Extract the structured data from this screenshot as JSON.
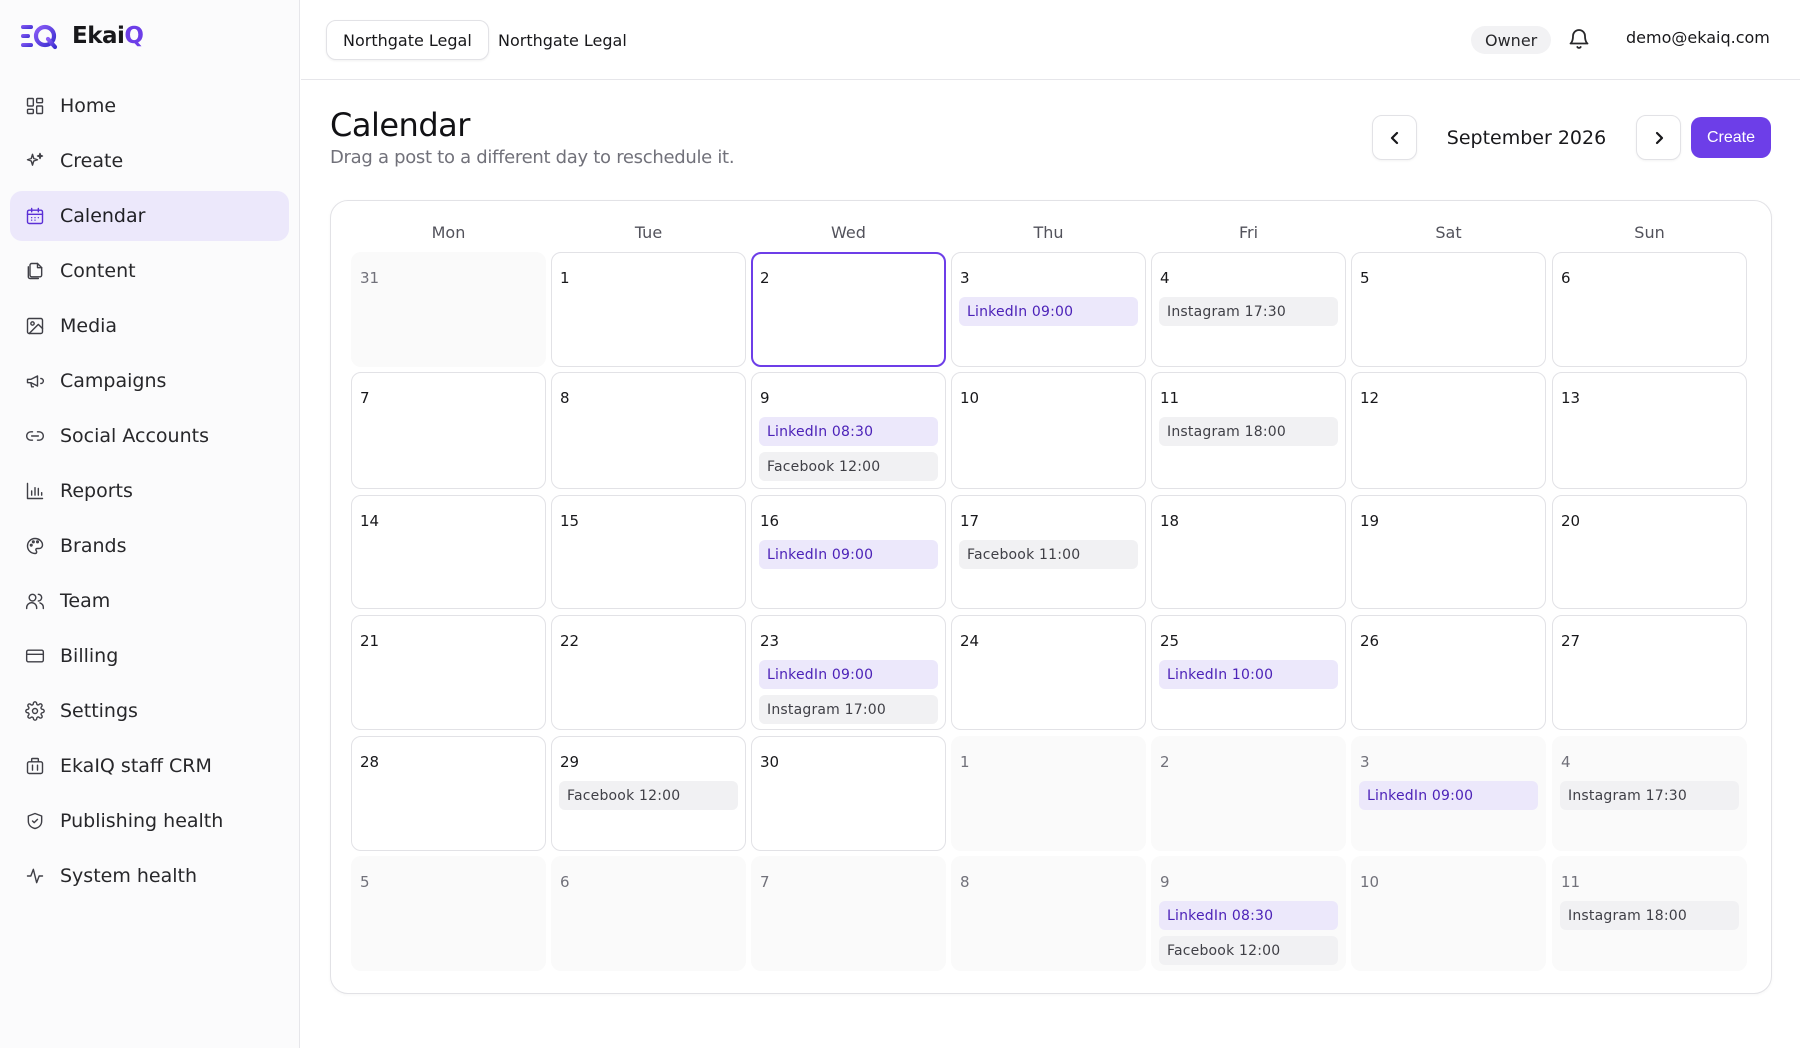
{
  "brand": {
    "name_main": "Ekai",
    "name_q": "Q"
  },
  "sidebar": {
    "items": [
      {
        "label": "Home",
        "icon": "home-grid-icon"
      },
      {
        "label": "Create",
        "icon": "sparkle-icon"
      },
      {
        "label": "Calendar",
        "icon": "calendar-icon",
        "active": true
      },
      {
        "label": "Content",
        "icon": "documents-icon"
      },
      {
        "label": "Media",
        "icon": "image-icon"
      },
      {
        "label": "Campaigns",
        "icon": "megaphone-icon"
      },
      {
        "label": "Social Accounts",
        "icon": "link-icon"
      },
      {
        "label": "Reports",
        "icon": "bar-chart-icon"
      },
      {
        "label": "Brands",
        "icon": "palette-icon"
      },
      {
        "label": "Team",
        "icon": "users-icon"
      },
      {
        "label": "Billing",
        "icon": "credit-card-icon"
      },
      {
        "label": "Settings",
        "icon": "gear-icon"
      },
      {
        "label": "EkaIQ staff CRM",
        "icon": "building-icon"
      },
      {
        "label": "Publishing health",
        "icon": "shield-check-icon"
      },
      {
        "label": "System health",
        "icon": "activity-icon"
      }
    ]
  },
  "topbar": {
    "tenant_tabs": [
      "Northgate Legal",
      "Northgate Legal"
    ],
    "role": "Owner",
    "user_email": "demo@ekaiq.com"
  },
  "page": {
    "title": "Calendar",
    "subtitle": "Drag a post to a different day to reschedule it.",
    "month": "September 2026",
    "create_label": "Create"
  },
  "colors": {
    "accent": "#6d3ee8",
    "accent_soft": "#ece8fb",
    "linkedin_text": "#4c22b8"
  },
  "calendar": {
    "weekdays": [
      "Mon",
      "Tue",
      "Wed",
      "Thu",
      "Fri",
      "Sat",
      "Sun"
    ],
    "weeks": [
      [
        {
          "day": "31",
          "muted": true,
          "posts": []
        },
        {
          "day": "1",
          "posts": []
        },
        {
          "day": "2",
          "today": true,
          "posts": []
        },
        {
          "day": "3",
          "posts": [
            {
              "label": "LinkedIn 09:00",
              "type": "linkedin"
            }
          ]
        },
        {
          "day": "4",
          "posts": [
            {
              "label": "Instagram 17:30",
              "type": "instagram"
            }
          ]
        },
        {
          "day": "5",
          "posts": []
        },
        {
          "day": "6",
          "posts": []
        }
      ],
      [
        {
          "day": "7",
          "posts": []
        },
        {
          "day": "8",
          "posts": []
        },
        {
          "day": "9",
          "posts": [
            {
              "label": "LinkedIn 08:30",
              "type": "linkedin"
            },
            {
              "label": "Facebook 12:00",
              "type": "facebook"
            }
          ]
        },
        {
          "day": "10",
          "posts": []
        },
        {
          "day": "11",
          "posts": [
            {
              "label": "Instagram 18:00",
              "type": "instagram"
            }
          ]
        },
        {
          "day": "12",
          "posts": []
        },
        {
          "day": "13",
          "posts": []
        }
      ],
      [
        {
          "day": "14",
          "posts": []
        },
        {
          "day": "15",
          "posts": []
        },
        {
          "day": "16",
          "posts": [
            {
              "label": "LinkedIn 09:00",
              "type": "linkedin"
            }
          ]
        },
        {
          "day": "17",
          "posts": [
            {
              "label": "Facebook 11:00",
              "type": "facebook"
            }
          ]
        },
        {
          "day": "18",
          "posts": []
        },
        {
          "day": "19",
          "posts": []
        },
        {
          "day": "20",
          "posts": []
        }
      ],
      [
        {
          "day": "21",
          "posts": []
        },
        {
          "day": "22",
          "posts": []
        },
        {
          "day": "23",
          "posts": [
            {
              "label": "LinkedIn 09:00",
              "type": "linkedin"
            },
            {
              "label": "Instagram 17:00",
              "type": "instagram"
            }
          ]
        },
        {
          "day": "24",
          "posts": []
        },
        {
          "day": "25",
          "posts": [
            {
              "label": "LinkedIn 10:00",
              "type": "linkedin"
            }
          ]
        },
        {
          "day": "26",
          "posts": []
        },
        {
          "day": "27",
          "posts": []
        }
      ],
      [
        {
          "day": "28",
          "posts": []
        },
        {
          "day": "29",
          "posts": [
            {
              "label": "Facebook 12:00",
              "type": "facebook"
            }
          ]
        },
        {
          "day": "30",
          "posts": []
        },
        {
          "day": "1",
          "muted": true,
          "posts": []
        },
        {
          "day": "2",
          "muted": true,
          "posts": []
        },
        {
          "day": "3",
          "muted": true,
          "posts": [
            {
              "label": "LinkedIn 09:00",
              "type": "linkedin"
            }
          ]
        },
        {
          "day": "4",
          "muted": true,
          "posts": [
            {
              "label": "Instagram 17:30",
              "type": "instagram"
            }
          ]
        }
      ],
      [
        {
          "day": "5",
          "muted": true,
          "posts": []
        },
        {
          "day": "6",
          "muted": true,
          "posts": []
        },
        {
          "day": "7",
          "muted": true,
          "posts": []
        },
        {
          "day": "8",
          "muted": true,
          "posts": []
        },
        {
          "day": "9",
          "muted": true,
          "posts": [
            {
              "label": "LinkedIn 08:30",
              "type": "linkedin"
            },
            {
              "label": "Facebook 12:00",
              "type": "facebook"
            }
          ]
        },
        {
          "day": "10",
          "muted": true,
          "posts": []
        },
        {
          "day": "11",
          "muted": true,
          "posts": [
            {
              "label": "Instagram 18:00",
              "type": "instagram"
            }
          ]
        }
      ]
    ]
  }
}
